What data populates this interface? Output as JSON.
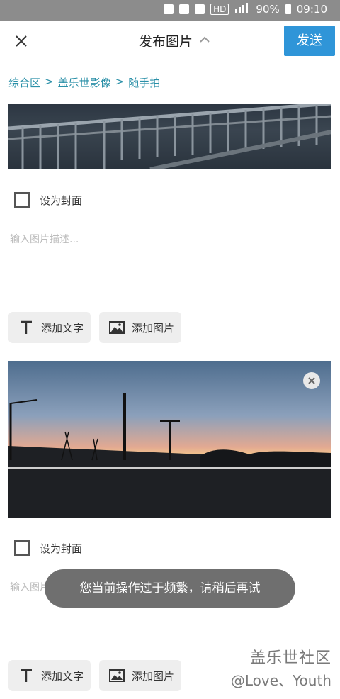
{
  "status_bar": {
    "battery": "90%",
    "time": "09:10",
    "hd_label": "HD",
    "icons": [
      "lock-icon",
      "nfc-icon",
      "alarm-icon",
      "hd-icon",
      "signal-icon",
      "battery-icon"
    ]
  },
  "header": {
    "close_icon": "close-icon",
    "title": "发布图片",
    "title_icon": "chevron-up-icon",
    "send_label": "发送",
    "accent": "#2f95d8"
  },
  "breadcrumb": {
    "items": [
      "综合区",
      "盖乐世影像",
      "随手拍"
    ],
    "separator": ">"
  },
  "posts": [
    {
      "cover_label": "设为封面",
      "description_placeholder": "输入图片描述...",
      "buttons": {
        "add_text": "添加文字",
        "add_image": "添加图片"
      }
    },
    {
      "cover_label": "设为封面",
      "description_placeholder": "输入图片描述...",
      "buttons": {
        "add_text": "添加文字",
        "add_image": "添加图片"
      }
    }
  ],
  "toast": {
    "message": "您当前操作过于频繁，请稍后再试"
  },
  "watermark": {
    "line1": "盖乐世社区",
    "line2": "@Love、Youth"
  }
}
